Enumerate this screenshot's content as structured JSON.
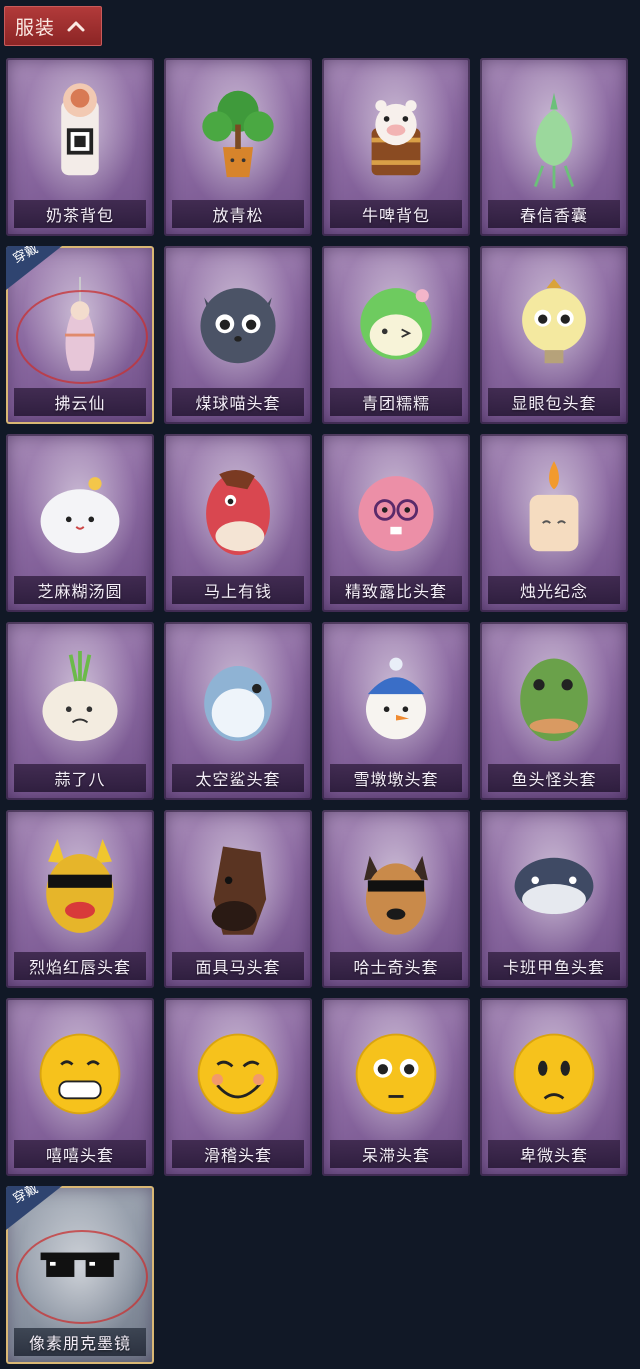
{
  "header": {
    "title": "服装",
    "chevron_icon": "chevron-up-icon"
  },
  "badge_text": "穿戴",
  "items": [
    {
      "label": "奶茶背包",
      "icon": "milk-tea-backpack-icon",
      "equipped": false
    },
    {
      "label": "放青松",
      "icon": "potted-pine-icon",
      "equipped": false
    },
    {
      "label": "牛啤背包",
      "icon": "cow-beer-backpack-icon",
      "equipped": false
    },
    {
      "label": "春信香囊",
      "icon": "sachet-icon",
      "equipped": false
    },
    {
      "label": "拂云仙",
      "icon": "fairy-charm-icon",
      "equipped": true
    },
    {
      "label": "煤球喵头套",
      "icon": "black-cat-mask-icon",
      "equipped": false
    },
    {
      "label": "青团糯糯",
      "icon": "green-dumpling-icon",
      "equipped": false
    },
    {
      "label": "显眼包头套",
      "icon": "lightbulb-mask-icon",
      "equipped": false
    },
    {
      "label": "芝麻糊汤圆",
      "icon": "rice-ball-icon",
      "equipped": false
    },
    {
      "label": "马上有钱",
      "icon": "red-horse-mask-icon",
      "equipped": false
    },
    {
      "label": "精致露比头套",
      "icon": "pink-beaver-mask-icon",
      "equipped": false
    },
    {
      "label": "烛光纪念",
      "icon": "candle-icon",
      "equipped": false
    },
    {
      "label": "蒜了八",
      "icon": "garlic-icon",
      "equipped": false
    },
    {
      "label": "太空鲨头套",
      "icon": "shark-mask-icon",
      "equipped": false
    },
    {
      "label": "雪墩墩头套",
      "icon": "snowman-mask-icon",
      "equipped": false
    },
    {
      "label": "鱼头怪头套",
      "icon": "fish-head-mask-icon",
      "equipped": false
    },
    {
      "label": "烈焰红唇头套",
      "icon": "yellow-lips-mask-icon",
      "equipped": false
    },
    {
      "label": "面具马头套",
      "icon": "horse-mask-icon",
      "equipped": false
    },
    {
      "label": "哈士奇头套",
      "icon": "husky-mask-icon",
      "equipped": false
    },
    {
      "label": "卡班甲鱼头套",
      "icon": "seal-mask-icon",
      "equipped": false
    },
    {
      "label": "嘻嘻头套",
      "icon": "grin-emoji-mask-icon",
      "equipped": false
    },
    {
      "label": "滑稽头套",
      "icon": "smirk-emoji-mask-icon",
      "equipped": false
    },
    {
      "label": "呆滞头套",
      "icon": "stare-emoji-mask-icon",
      "equipped": false
    },
    {
      "label": "卑微头套",
      "icon": "humble-emoji-mask-icon",
      "equipped": false
    },
    {
      "label": "像素朋克墨镜",
      "icon": "pixel-sunglasses-icon",
      "equipped": true
    }
  ]
}
